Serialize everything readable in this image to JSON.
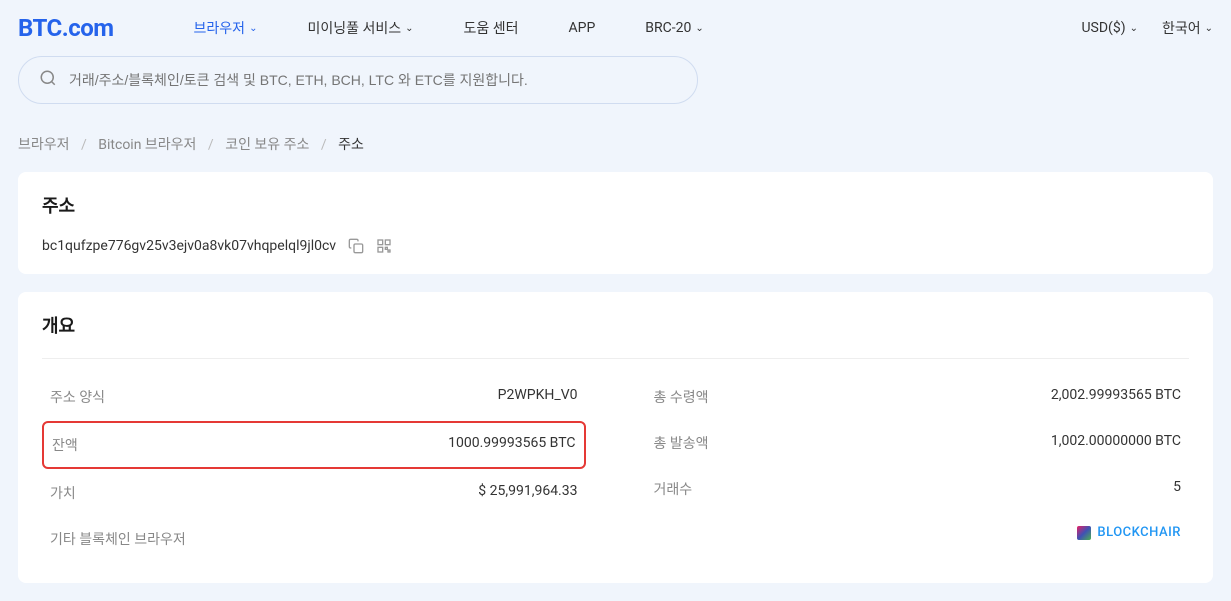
{
  "header": {
    "logo": "BTC.com",
    "nav": [
      {
        "label": "브라우저",
        "active": true,
        "dropdown": true
      },
      {
        "label": "미이닝풀 서비스",
        "active": false,
        "dropdown": true
      },
      {
        "label": "도움 센터",
        "active": false,
        "dropdown": false
      },
      {
        "label": "APP",
        "active": false,
        "dropdown": false
      },
      {
        "label": "BRC-20",
        "active": false,
        "dropdown": true
      }
    ],
    "right": [
      {
        "label": "USD($)",
        "dropdown": true
      },
      {
        "label": "한국어",
        "dropdown": true
      }
    ]
  },
  "search": {
    "placeholder": "거래/주소/블록체인/토큰 검색 및 BTC, ETH, BCH, LTC 와 ETC를 지원합니다."
  },
  "breadcrumb": {
    "items": [
      "브라우저",
      "Bitcoin 브라우저",
      "코인 보유 주소"
    ],
    "current": "주소"
  },
  "address_card": {
    "title": "주소",
    "address": "bc1qufzpe776gv25v3ejv0a8vk07vhqpelql9jl0cv"
  },
  "overview": {
    "title": "개요",
    "left": [
      {
        "label": "주소 양식",
        "value": "P2WPKH_V0",
        "highlight": false
      },
      {
        "label": "잔액",
        "value": "1000.99993565 BTC",
        "highlight": true
      },
      {
        "label": "가치",
        "value": "$ 25,991,964.33",
        "highlight": false
      },
      {
        "label": "기타 블록체인 브라우저",
        "value": "",
        "highlight": false
      }
    ],
    "right": [
      {
        "label": "총 수령액",
        "value": "2,002.99993565 BTC"
      },
      {
        "label": "총 발송액",
        "value": "1,002.00000000 BTC"
      },
      {
        "label": "거래수",
        "value": "5"
      }
    ],
    "blockchair_label": "BLOCKCHAIR"
  }
}
